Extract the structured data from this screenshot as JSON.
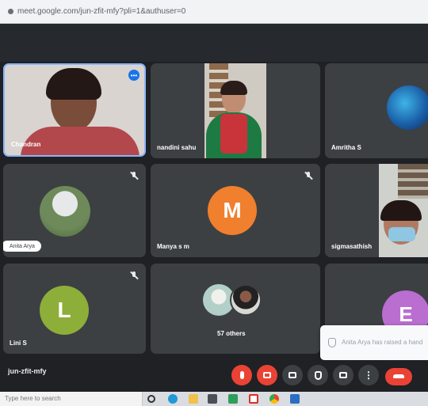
{
  "browser": {
    "url": "meet.google.com/jun-zfit-mfy?pli=1&authuser=0"
  },
  "meeting": {
    "code": "jun-zfit-mfy"
  },
  "participants": [
    {
      "name": "Chandran",
      "muted": false,
      "speaking": true
    },
    {
      "name": "nandini sahu",
      "muted": false
    },
    {
      "name": "Amritha S",
      "muted": false
    },
    {
      "name": "Anita Arya",
      "muted": true
    },
    {
      "name": "Manya s m",
      "muted": true,
      "avatar_letter": "M",
      "avatar_color": "#f07f2e"
    },
    {
      "name": "sigmasathish",
      "muted": false
    },
    {
      "name": "Lini S",
      "muted": true,
      "avatar_letter": "L",
      "avatar_color": "#8eae3a"
    },
    {
      "name": "57 others",
      "muted": false
    },
    {
      "name": "",
      "muted": false,
      "avatar_letter": "E",
      "avatar_color": "#b96ed0"
    }
  ],
  "toast": {
    "message": "Anita Arya has raised a hand"
  },
  "controls": [
    {
      "icon": "mic-off-icon",
      "color": "#ea4335"
    },
    {
      "icon": "camera-off-icon",
      "color": "#ea4335"
    },
    {
      "icon": "captions-icon"
    },
    {
      "icon": "raise-hand-icon"
    },
    {
      "icon": "present-icon"
    },
    {
      "icon": "more-options-icon"
    },
    {
      "icon": "end-call-icon",
      "color": "#ea4335"
    }
  ],
  "taskbar": {
    "search_placeholder": "Type here to search"
  },
  "colors": {
    "tile_bg": "#3c4043",
    "page_bg": "#1f2125",
    "accent_red": "#ea4335",
    "speaking_border": "#8ab4f8"
  }
}
